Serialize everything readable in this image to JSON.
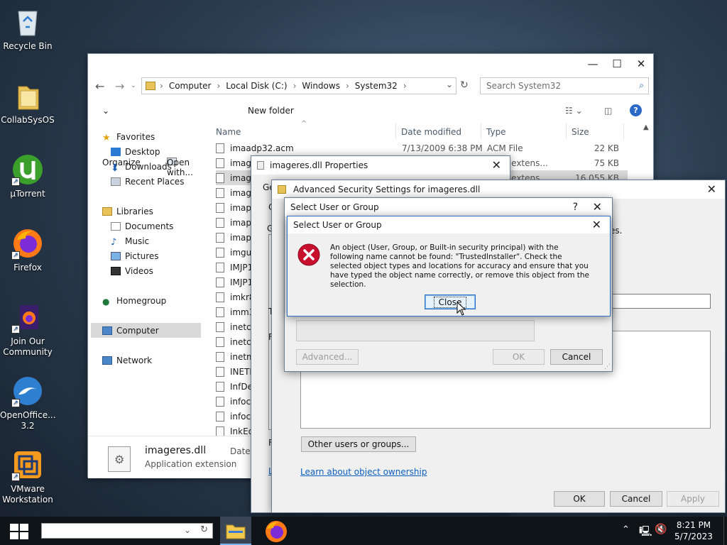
{
  "desktop": {
    "icons": [
      {
        "label": "Recycle Bin"
      },
      {
        "label": "CollabSysOS"
      },
      {
        "label": "µTorrent"
      },
      {
        "label": "Firefox"
      },
      {
        "label": "Join Our Community"
      },
      {
        "label": "OpenOffice... 3.2"
      },
      {
        "label": "VMware Workstation"
      }
    ]
  },
  "explorer": {
    "breadcrumb": [
      "Computer",
      "Local Disk (C:)",
      "Windows",
      "System32"
    ],
    "search_placeholder": "Search System32",
    "toolbar": {
      "organize": "Organize",
      "open_with": "Open with...",
      "new_folder": "New folder"
    },
    "nav": {
      "favorites": "Favorites",
      "desktop": "Desktop",
      "downloads": "Downloads",
      "recent_places": "Recent Places",
      "libraries": "Libraries",
      "documents": "Documents",
      "music": "Music",
      "pictures": "Pictures",
      "videos": "Videos",
      "homegroup": "Homegroup",
      "computer": "Computer",
      "network": "Network"
    },
    "columns": {
      "name": "Name",
      "date": "Date modified",
      "type": "Type",
      "size": "Size"
    },
    "files": [
      {
        "name": "imaadp32.acm",
        "date": "7/13/2009 6:38 PM",
        "type": "ACM File",
        "size": "22 KB"
      },
      {
        "name": "image",
        "date": "",
        "type": "ation extens...",
        "size": "75 KB"
      },
      {
        "name": "image",
        "date": "",
        "type": "ation extens...",
        "size": "16,055 KB"
      },
      {
        "name": "image",
        "date": "",
        "type": "",
        "size": ""
      },
      {
        "name": "imapi",
        "date": "",
        "type": "",
        "size": ""
      },
      {
        "name": "imapi",
        "date": "",
        "type": "",
        "size": ""
      },
      {
        "name": "imapi",
        "date": "",
        "type": "",
        "size": ""
      },
      {
        "name": "imgut",
        "date": "",
        "type": "",
        "size": ""
      },
      {
        "name": "IMJP1",
        "date": "",
        "type": "",
        "size": ""
      },
      {
        "name": "IMJP1",
        "date": "",
        "type": "",
        "size": ""
      },
      {
        "name": "imkr8",
        "date": "",
        "type": "",
        "size": ""
      },
      {
        "name": "imm3",
        "date": "",
        "type": "",
        "size": ""
      },
      {
        "name": "inetcc",
        "date": "",
        "type": "",
        "size": ""
      },
      {
        "name": "inetcp",
        "date": "",
        "type": "",
        "size": ""
      },
      {
        "name": "inetm",
        "date": "",
        "type": "",
        "size": ""
      },
      {
        "name": "INETR",
        "date": "",
        "type": "",
        "size": ""
      },
      {
        "name": "InfDef",
        "date": "",
        "type": "",
        "size": ""
      },
      {
        "name": "infoca",
        "date": "",
        "type": "",
        "size": ""
      },
      {
        "name": "infoca",
        "date": "",
        "type": "",
        "size": ""
      },
      {
        "name": "InkEd",
        "date": "",
        "type": "",
        "size": ""
      }
    ],
    "details": {
      "name": "imageres.dll",
      "type": "Application extension",
      "date_label": "Date m"
    }
  },
  "properties": {
    "title": "imageres.dll Properties",
    "tab_first": "Ge",
    "stub_g": "G",
    "stub_t": "T",
    "stub_f1": "F",
    "stub_f2": "F",
    "stub_l": "L"
  },
  "advanced_security": {
    "title": "Advanced Security Settings for imageres.dll",
    "partial_text": "es.",
    "other_users_button": "Other users or groups...",
    "ownership_link": "Learn about object ownership",
    "ok": "OK",
    "cancel": "Cancel",
    "apply": "Apply"
  },
  "select_user_outer": {
    "title": "Select User or Group",
    "help": "?",
    "advanced": "Advanced...",
    "ok": "OK",
    "cancel": "Cancel"
  },
  "error_dialog": {
    "title": "Select User or Group",
    "message": "An object (User, Group, or Built-in security principal) with the following name cannot be found: \"TrustedInstaller\". Check the selected object types and locations for accuracy and ensure that you have typed the object name correctly, or remove this object from the selection.",
    "close": "Close"
  },
  "taskbar": {
    "time": "8:21 PM",
    "date": "5/7/2023"
  },
  "colors": {
    "accent": "#0b5fc0",
    "error_red": "#c8102e",
    "selection": "#cce8ff"
  }
}
